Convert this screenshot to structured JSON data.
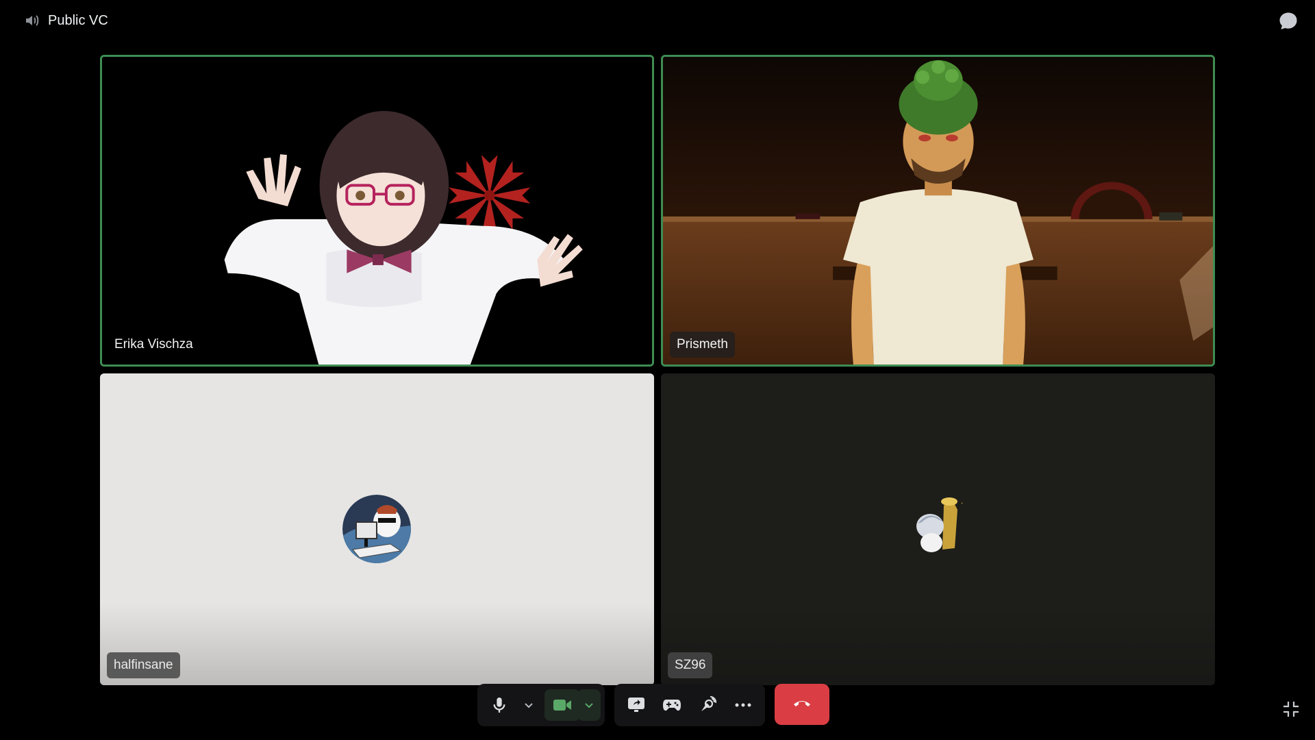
{
  "channel": {
    "name": "Public VC",
    "icon": "speaker-icon"
  },
  "header": {
    "chat_icon": "chat-bubble-icon"
  },
  "participants": [
    {
      "name": "Erika Vischza",
      "speaking": true,
      "video": true
    },
    {
      "name": "Prismeth",
      "speaking": true,
      "video": true
    },
    {
      "name": "halfinsane",
      "speaking": false,
      "video": false
    },
    {
      "name": "SZ96",
      "speaking": false,
      "video": false
    }
  ],
  "controls": {
    "mic_icon": "microphone-icon",
    "mic_options_icon": "chevron-down-icon",
    "camera_icon": "video-camera-icon",
    "camera_options_icon": "chevron-down-icon",
    "share_icon": "screen-share-icon",
    "activity_icon": "gamepad-icon",
    "soundboard_icon": "soundboard-icon",
    "more_icon": "more-horizontal-icon",
    "leave_icon": "hang-up-icon"
  },
  "footer": {
    "minimize_icon": "minimize-icon"
  },
  "colors": {
    "speaking_border": "#3e8d52",
    "leave_button": "#da3e44",
    "camera_active": "#5aa867"
  }
}
